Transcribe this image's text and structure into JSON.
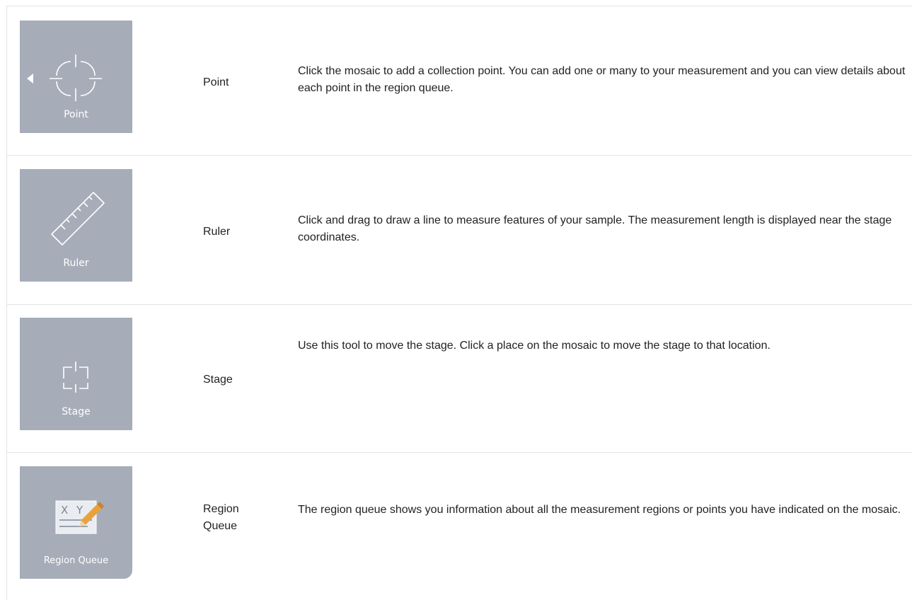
{
  "rows": [
    {
      "icon": "crosshair-point-icon",
      "tile_label": "Point",
      "name": "Point",
      "description": "Click the mosaic to add a collection point. You can add one or many to your measurement and you can view details about each point in the region queue."
    },
    {
      "icon": "ruler-icon",
      "tile_label": "Ruler",
      "name": "Ruler",
      "description": "Click and drag to draw a line to measure features of your sample. The measurement length is displayed near the stage coordinates."
    },
    {
      "icon": "stage-move-icon",
      "tile_label": "Stage",
      "name": "Stage",
      "description": "Use this tool to move the stage. Click a place on the mosaic to move the stage to that location."
    },
    {
      "icon": "region-queue-icon",
      "tile_label": "Region Queue",
      "name": "Region Queue",
      "description": "The region queue shows you information about all the measurement regions or points you have indicated on the mosaic."
    }
  ],
  "colors": {
    "tile_background": "#a6adb9",
    "tile_foreground": "#ffffff",
    "pencil_accent": "#e9a23b",
    "divider": "#e3e3e3"
  }
}
